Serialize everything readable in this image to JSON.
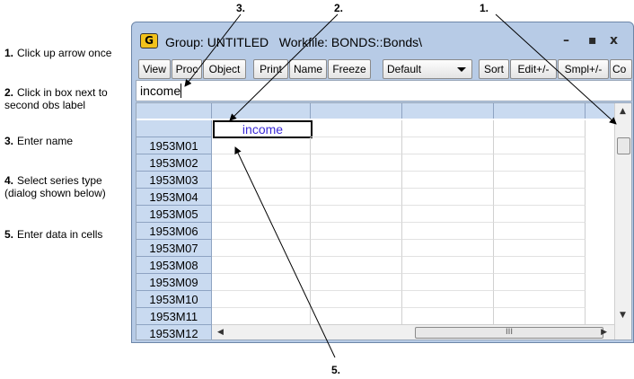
{
  "callouts": [
    {
      "num": "1.",
      "text": "Click up arrow once"
    },
    {
      "num": "2.",
      "text": "Click in box next to second obs label"
    },
    {
      "num": "3.",
      "text": "Enter name"
    },
    {
      "num": "4.",
      "text": "Select series type (dialog shown below)"
    },
    {
      "num": "5.",
      "text": "Enter data in cells"
    }
  ],
  "markers": {
    "m1": "1.",
    "m2": "2.",
    "m3": "3.",
    "m5": "5."
  },
  "window": {
    "icon": "G",
    "title": "Group: UNTITLED   Workfile: BONDS::Bonds\\",
    "minimize": "–",
    "maximize": "▪",
    "close": "x"
  },
  "toolbar": {
    "view": "View",
    "proc": "Proc",
    "object": "Object",
    "print": "Print",
    "name": "Name",
    "freeze": "Freeze",
    "dropdown_value": "Default",
    "sort": "Sort",
    "edit": "Edit+/-",
    "smpl": "Smpl+/-",
    "more": "Co"
  },
  "command_line": {
    "value": "income"
  },
  "grid": {
    "series_name": "income",
    "rows": [
      "1953M01",
      "1953M02",
      "1953M03",
      "1953M04",
      "1953M05",
      "1953M06",
      "1953M07",
      "1953M08",
      "1953M09",
      "1953M10",
      "1953M11",
      "1953M12"
    ],
    "hscroll_grip": "III"
  },
  "colors": {
    "window_frame": "#b7cbe6",
    "label_bg": "#c9daf0",
    "name_text": "#3b2ad6"
  },
  "icons": [
    "g-app-icon",
    "minimize-icon",
    "maximize-icon",
    "close-icon",
    "up-arrow-icon",
    "down-arrow-icon",
    "left-arrow-icon",
    "right-arrow-icon",
    "dropdown-arrow-icon"
  ]
}
